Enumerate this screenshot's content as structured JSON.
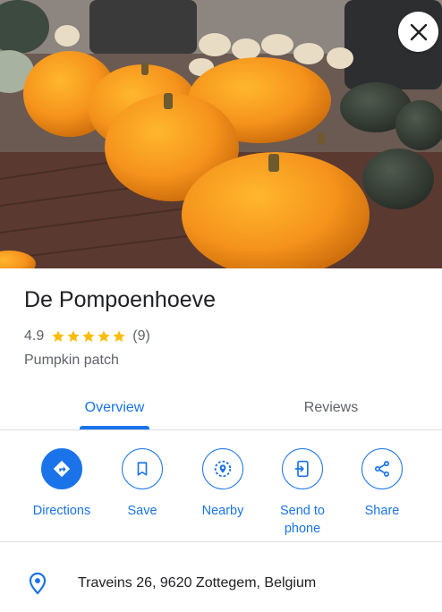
{
  "place": {
    "name": "De Pompoenhoeve",
    "rating": "4.9",
    "star_count": 5,
    "review_count": "(9)",
    "category": "Pumpkin patch",
    "hero_photo_icon": "pumpkin-photo",
    "close_icon": "close-icon"
  },
  "tabs": [
    {
      "label": "Overview",
      "selected": true
    },
    {
      "label": "Reviews",
      "selected": false
    }
  ],
  "actions": [
    {
      "label": "Directions",
      "icon": "directions-icon",
      "primary": true
    },
    {
      "label": "Save",
      "icon": "bookmark-icon",
      "primary": false
    },
    {
      "label": "Nearby",
      "icon": "nearby-icon",
      "primary": false
    },
    {
      "label": "Send to phone",
      "icon": "send-to-phone-icon",
      "primary": false
    },
    {
      "label": "Share",
      "icon": "share-icon",
      "primary": false
    }
  ],
  "address": {
    "text": "Traveins 26, 9620 Zottegem, Belgium",
    "icon": "location-pin-icon"
  },
  "colors": {
    "accent": "#1a73e8",
    "star": "#fbbc04",
    "text_primary": "#202124",
    "text_secondary": "#5f6368"
  }
}
